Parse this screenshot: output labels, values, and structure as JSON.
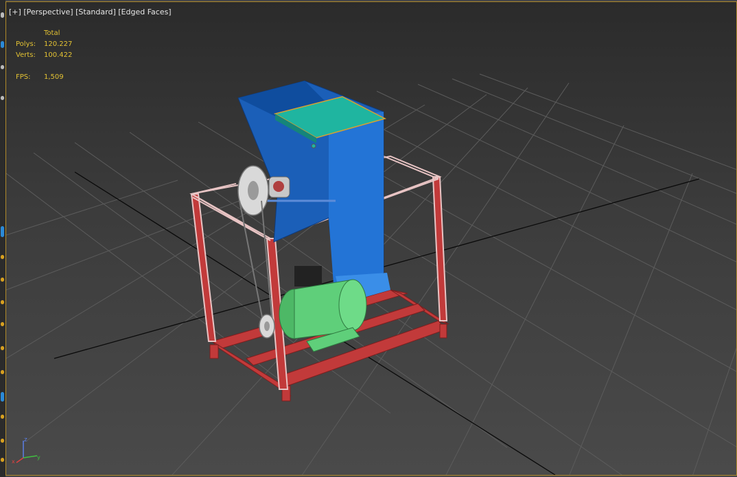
{
  "viewport": {
    "label_parts": [
      "[+]",
      "[Perspective]",
      "[Standard]",
      "[Edged Faces]"
    ],
    "border_color": "#b08a2a"
  },
  "stats": {
    "header": "Total",
    "polys_label": "Polys:",
    "polys_value": "120.227",
    "verts_label": "Verts:",
    "verts_value": "100.422",
    "fps_label": "FPS:",
    "fps_value": "1,509",
    "text_color": "#e3c233"
  },
  "scene": {
    "hopper_color": "#1e6fd0",
    "lid_color": "#1fb5a0",
    "frame_color": "#c23a3a",
    "motor_color": "#5fcf7a",
    "pulley_color": "#d9d9d9"
  },
  "axis_gizmo": {
    "z_label": "z",
    "x_label": "x",
    "y_label": "y"
  }
}
